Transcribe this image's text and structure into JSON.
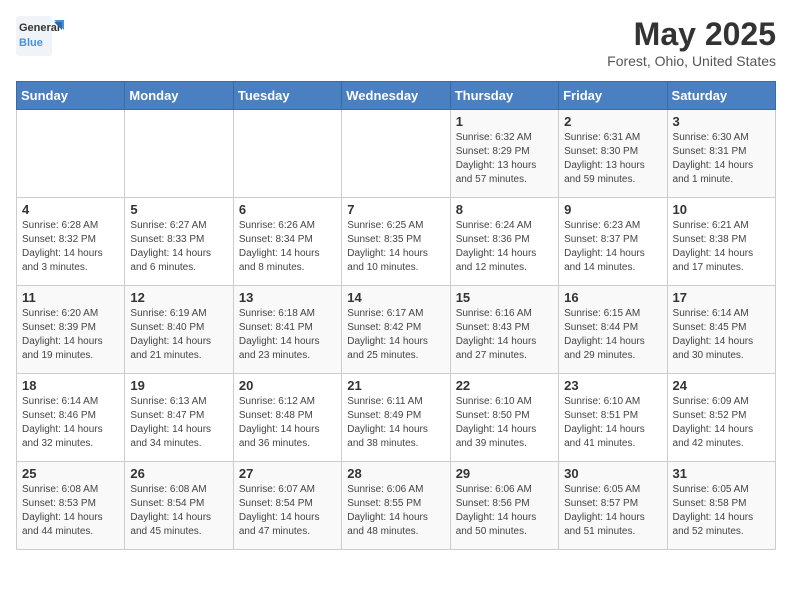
{
  "header": {
    "logo_line1": "General",
    "logo_line2": "Blue",
    "month": "May 2025",
    "location": "Forest, Ohio, United States"
  },
  "weekdays": [
    "Sunday",
    "Monday",
    "Tuesday",
    "Wednesday",
    "Thursday",
    "Friday",
    "Saturday"
  ],
  "weeks": [
    [
      {
        "day": "",
        "sunrise": "",
        "sunset": "",
        "daylight": ""
      },
      {
        "day": "",
        "sunrise": "",
        "sunset": "",
        "daylight": ""
      },
      {
        "day": "",
        "sunrise": "",
        "sunset": "",
        "daylight": ""
      },
      {
        "day": "",
        "sunrise": "",
        "sunset": "",
        "daylight": ""
      },
      {
        "day": "1",
        "sunrise": "Sunrise: 6:32 AM",
        "sunset": "Sunset: 8:29 PM",
        "daylight": "Daylight: 13 hours and 57 minutes."
      },
      {
        "day": "2",
        "sunrise": "Sunrise: 6:31 AM",
        "sunset": "Sunset: 8:30 PM",
        "daylight": "Daylight: 13 hours and 59 minutes."
      },
      {
        "day": "3",
        "sunrise": "Sunrise: 6:30 AM",
        "sunset": "Sunset: 8:31 PM",
        "daylight": "Daylight: 14 hours and 1 minute."
      }
    ],
    [
      {
        "day": "4",
        "sunrise": "Sunrise: 6:28 AM",
        "sunset": "Sunset: 8:32 PM",
        "daylight": "Daylight: 14 hours and 3 minutes."
      },
      {
        "day": "5",
        "sunrise": "Sunrise: 6:27 AM",
        "sunset": "Sunset: 8:33 PM",
        "daylight": "Daylight: 14 hours and 6 minutes."
      },
      {
        "day": "6",
        "sunrise": "Sunrise: 6:26 AM",
        "sunset": "Sunset: 8:34 PM",
        "daylight": "Daylight: 14 hours and 8 minutes."
      },
      {
        "day": "7",
        "sunrise": "Sunrise: 6:25 AM",
        "sunset": "Sunset: 8:35 PM",
        "daylight": "Daylight: 14 hours and 10 minutes."
      },
      {
        "day": "8",
        "sunrise": "Sunrise: 6:24 AM",
        "sunset": "Sunset: 8:36 PM",
        "daylight": "Daylight: 14 hours and 12 minutes."
      },
      {
        "day": "9",
        "sunrise": "Sunrise: 6:23 AM",
        "sunset": "Sunset: 8:37 PM",
        "daylight": "Daylight: 14 hours and 14 minutes."
      },
      {
        "day": "10",
        "sunrise": "Sunrise: 6:21 AM",
        "sunset": "Sunset: 8:38 PM",
        "daylight": "Daylight: 14 hours and 17 minutes."
      }
    ],
    [
      {
        "day": "11",
        "sunrise": "Sunrise: 6:20 AM",
        "sunset": "Sunset: 8:39 PM",
        "daylight": "Daylight: 14 hours and 19 minutes."
      },
      {
        "day": "12",
        "sunrise": "Sunrise: 6:19 AM",
        "sunset": "Sunset: 8:40 PM",
        "daylight": "Daylight: 14 hours and 21 minutes."
      },
      {
        "day": "13",
        "sunrise": "Sunrise: 6:18 AM",
        "sunset": "Sunset: 8:41 PM",
        "daylight": "Daylight: 14 hours and 23 minutes."
      },
      {
        "day": "14",
        "sunrise": "Sunrise: 6:17 AM",
        "sunset": "Sunset: 8:42 PM",
        "daylight": "Daylight: 14 hours and 25 minutes."
      },
      {
        "day": "15",
        "sunrise": "Sunrise: 6:16 AM",
        "sunset": "Sunset: 8:43 PM",
        "daylight": "Daylight: 14 hours and 27 minutes."
      },
      {
        "day": "16",
        "sunrise": "Sunrise: 6:15 AM",
        "sunset": "Sunset: 8:44 PM",
        "daylight": "Daylight: 14 hours and 29 minutes."
      },
      {
        "day": "17",
        "sunrise": "Sunrise: 6:14 AM",
        "sunset": "Sunset: 8:45 PM",
        "daylight": "Daylight: 14 hours and 30 minutes."
      }
    ],
    [
      {
        "day": "18",
        "sunrise": "Sunrise: 6:14 AM",
        "sunset": "Sunset: 8:46 PM",
        "daylight": "Daylight: 14 hours and 32 minutes."
      },
      {
        "day": "19",
        "sunrise": "Sunrise: 6:13 AM",
        "sunset": "Sunset: 8:47 PM",
        "daylight": "Daylight: 14 hours and 34 minutes."
      },
      {
        "day": "20",
        "sunrise": "Sunrise: 6:12 AM",
        "sunset": "Sunset: 8:48 PM",
        "daylight": "Daylight: 14 hours and 36 minutes."
      },
      {
        "day": "21",
        "sunrise": "Sunrise: 6:11 AM",
        "sunset": "Sunset: 8:49 PM",
        "daylight": "Daylight: 14 hours and 38 minutes."
      },
      {
        "day": "22",
        "sunrise": "Sunrise: 6:10 AM",
        "sunset": "Sunset: 8:50 PM",
        "daylight": "Daylight: 14 hours and 39 minutes."
      },
      {
        "day": "23",
        "sunrise": "Sunrise: 6:10 AM",
        "sunset": "Sunset: 8:51 PM",
        "daylight": "Daylight: 14 hours and 41 minutes."
      },
      {
        "day": "24",
        "sunrise": "Sunrise: 6:09 AM",
        "sunset": "Sunset: 8:52 PM",
        "daylight": "Daylight: 14 hours and 42 minutes."
      }
    ],
    [
      {
        "day": "25",
        "sunrise": "Sunrise: 6:08 AM",
        "sunset": "Sunset: 8:53 PM",
        "daylight": "Daylight: 14 hours and 44 minutes."
      },
      {
        "day": "26",
        "sunrise": "Sunrise: 6:08 AM",
        "sunset": "Sunset: 8:54 PM",
        "daylight": "Daylight: 14 hours and 45 minutes."
      },
      {
        "day": "27",
        "sunrise": "Sunrise: 6:07 AM",
        "sunset": "Sunset: 8:54 PM",
        "daylight": "Daylight: 14 hours and 47 minutes."
      },
      {
        "day": "28",
        "sunrise": "Sunrise: 6:06 AM",
        "sunset": "Sunset: 8:55 PM",
        "daylight": "Daylight: 14 hours and 48 minutes."
      },
      {
        "day": "29",
        "sunrise": "Sunrise: 6:06 AM",
        "sunset": "Sunset: 8:56 PM",
        "daylight": "Daylight: 14 hours and 50 minutes."
      },
      {
        "day": "30",
        "sunrise": "Sunrise: 6:05 AM",
        "sunset": "Sunset: 8:57 PM",
        "daylight": "Daylight: 14 hours and 51 minutes."
      },
      {
        "day": "31",
        "sunrise": "Sunrise: 6:05 AM",
        "sunset": "Sunset: 8:58 PM",
        "daylight": "Daylight: 14 hours and 52 minutes."
      }
    ]
  ]
}
